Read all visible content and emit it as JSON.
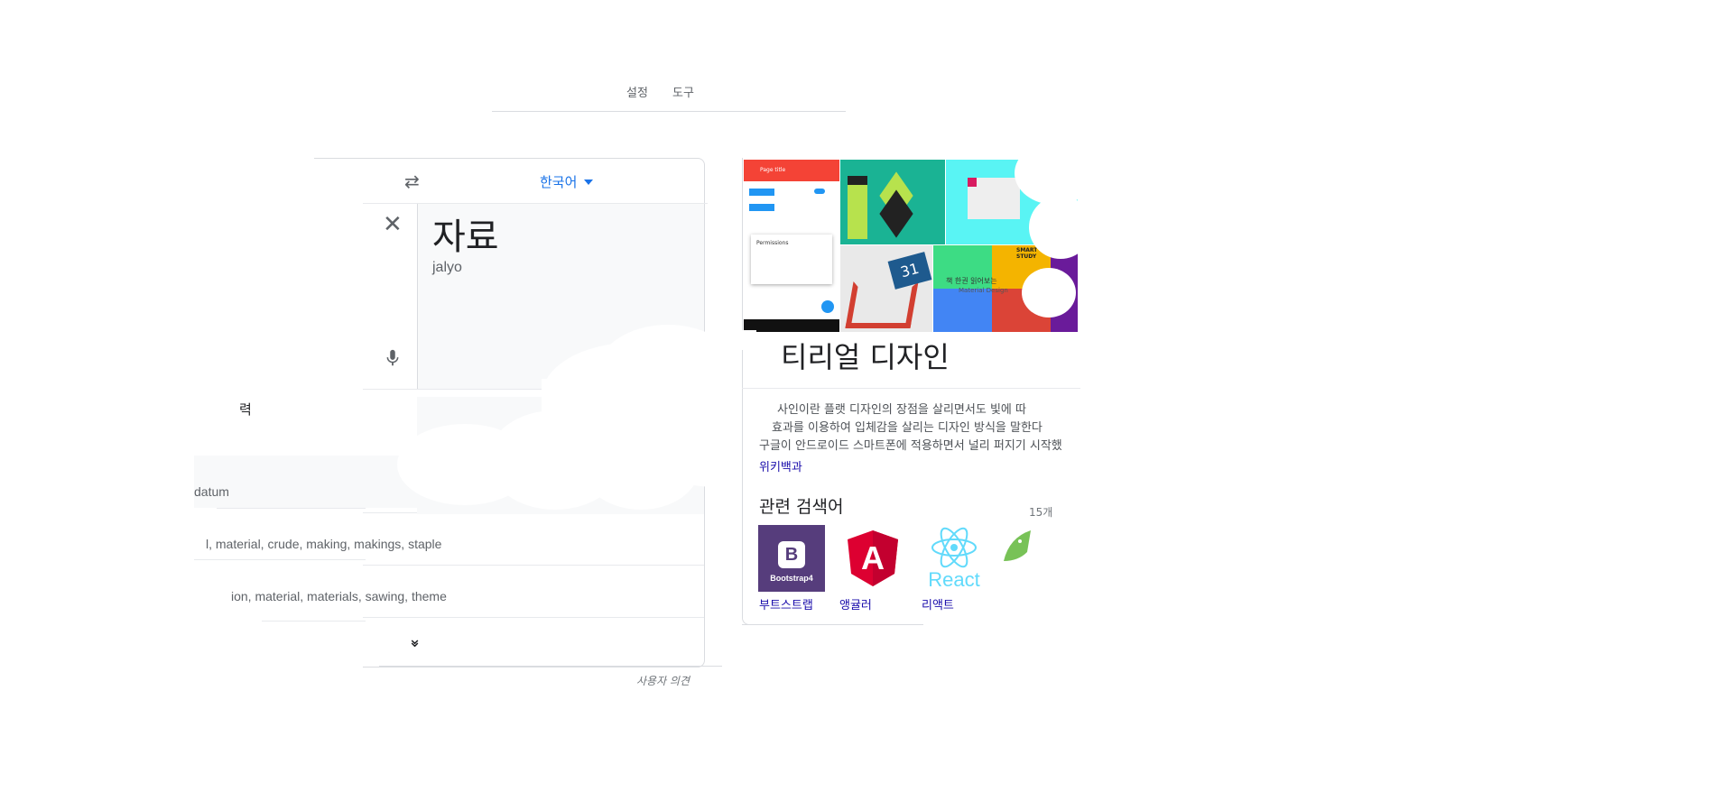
{
  "top_links": {
    "settings": "설정",
    "tools": "도구"
  },
  "translate": {
    "swap_icon": "swap-horizontal-icon",
    "target_lang": "한국어",
    "translation": "자료",
    "transliteration": "jalyo",
    "left_fragment": "력",
    "dict_rows": [
      "datum",
      "l, material, crude, making, makings, staple",
      "ion, material, materials, sawing, theme"
    ],
    "feedback": "사용자 의견"
  },
  "knowledge_panel": {
    "title": "머티리얼 디자인",
    "title_visible": "티리얼 디자인",
    "desc_lines": [
      "사인이란 플랫 디자인의 장점을 살리면서도 빛에 따",
      "효과를 이용하여 입체감을 살리는 디자인 방식을 말한다",
      "구글이 안드로이드 스마트폰에 적용하면서 널리 퍼지기 시작했"
    ],
    "source": "위키백과",
    "related_title": "관련 검색어",
    "related_count": "15개",
    "related": [
      {
        "label": "부트스트랩",
        "logo_text": "Bootstrap4",
        "logo_glyph": "B"
      },
      {
        "label": "앵귤러",
        "logo_glyph": "A"
      },
      {
        "label": "리액트",
        "logo_text": "React"
      },
      {
        "label": "",
        "icon": "android-icon"
      }
    ],
    "image_texts": {
      "app_title": "Page title",
      "dialog_title": "Permissions",
      "calendar_day": "31",
      "studio": "SMART STUDY",
      "banner_line1": "책 한권 읽어보는",
      "banner_line2": "Material Design"
    }
  },
  "colors": {
    "accent": "#1a73e8",
    "link": "#1a0dab",
    "bootstrap": "#563d7c",
    "angular": "#dd0031",
    "react": "#61dafb",
    "android": "#78c257"
  }
}
